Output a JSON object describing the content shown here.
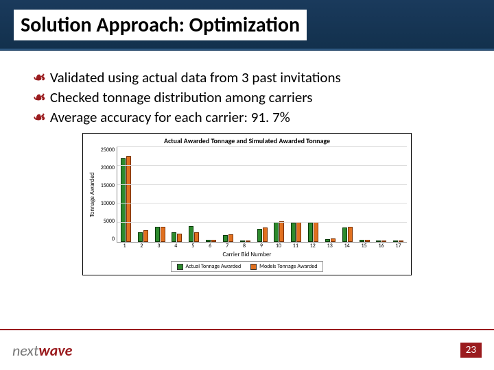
{
  "slide": {
    "title": "Solution Approach:  Optimization",
    "bullets": [
      "Validated using actual data from 3 past invitations",
      "Checked tonnage distribution among carriers",
      "Average accuracy for each carrier: 91. 7%"
    ],
    "page_number": "23",
    "logo_part1": "next",
    "logo_part2": "wave"
  },
  "chart_data": {
    "type": "bar",
    "title": "Actual Awarded Tonnage and Simulated Awarded Tonnage",
    "xlabel": "Carrier Bid Number",
    "ylabel": "Tonnage Awarded",
    "ylim": [
      0,
      25000
    ],
    "yticks": [
      0,
      5000,
      10000,
      15000,
      20000,
      25000
    ],
    "categories": [
      "1",
      "2",
      "3",
      "4",
      "5",
      "6",
      "7",
      "8",
      "9",
      "10",
      "11",
      "12",
      "13",
      "14",
      "15",
      "16",
      "17"
    ],
    "series": [
      {
        "name": "Actual Tonnage Awarded",
        "values": [
          22000,
          2500,
          4000,
          2500,
          4200,
          600,
          1800,
          0,
          3500,
          5200,
          5100,
          5000,
          700,
          3800,
          500,
          150,
          100
        ]
      },
      {
        "name": "Models Tonnage Awarded",
        "values": [
          22500,
          3000,
          4000,
          2200,
          2500,
          500,
          2000,
          200,
          3700,
          5400,
          5200,
          5200,
          900,
          3900,
          500,
          120,
          100
        ]
      }
    ]
  }
}
